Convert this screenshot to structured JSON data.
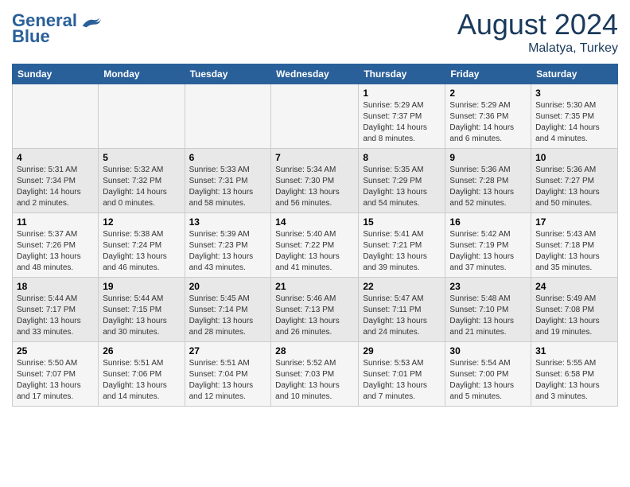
{
  "header": {
    "logo_line1": "General",
    "logo_line2": "Blue",
    "month_year": "August 2024",
    "location": "Malatya, Turkey"
  },
  "days_of_week": [
    "Sunday",
    "Monday",
    "Tuesday",
    "Wednesday",
    "Thursday",
    "Friday",
    "Saturday"
  ],
  "weeks": [
    [
      {
        "day": "",
        "info": ""
      },
      {
        "day": "",
        "info": ""
      },
      {
        "day": "",
        "info": ""
      },
      {
        "day": "",
        "info": ""
      },
      {
        "day": "1",
        "info": "Sunrise: 5:29 AM\nSunset: 7:37 PM\nDaylight: 14 hours\nand 8 minutes."
      },
      {
        "day": "2",
        "info": "Sunrise: 5:29 AM\nSunset: 7:36 PM\nDaylight: 14 hours\nand 6 minutes."
      },
      {
        "day": "3",
        "info": "Sunrise: 5:30 AM\nSunset: 7:35 PM\nDaylight: 14 hours\nand 4 minutes."
      }
    ],
    [
      {
        "day": "4",
        "info": "Sunrise: 5:31 AM\nSunset: 7:34 PM\nDaylight: 14 hours\nand 2 minutes."
      },
      {
        "day": "5",
        "info": "Sunrise: 5:32 AM\nSunset: 7:32 PM\nDaylight: 14 hours\nand 0 minutes."
      },
      {
        "day": "6",
        "info": "Sunrise: 5:33 AM\nSunset: 7:31 PM\nDaylight: 13 hours\nand 58 minutes."
      },
      {
        "day": "7",
        "info": "Sunrise: 5:34 AM\nSunset: 7:30 PM\nDaylight: 13 hours\nand 56 minutes."
      },
      {
        "day": "8",
        "info": "Sunrise: 5:35 AM\nSunset: 7:29 PM\nDaylight: 13 hours\nand 54 minutes."
      },
      {
        "day": "9",
        "info": "Sunrise: 5:36 AM\nSunset: 7:28 PM\nDaylight: 13 hours\nand 52 minutes."
      },
      {
        "day": "10",
        "info": "Sunrise: 5:36 AM\nSunset: 7:27 PM\nDaylight: 13 hours\nand 50 minutes."
      }
    ],
    [
      {
        "day": "11",
        "info": "Sunrise: 5:37 AM\nSunset: 7:26 PM\nDaylight: 13 hours\nand 48 minutes."
      },
      {
        "day": "12",
        "info": "Sunrise: 5:38 AM\nSunset: 7:24 PM\nDaylight: 13 hours\nand 46 minutes."
      },
      {
        "day": "13",
        "info": "Sunrise: 5:39 AM\nSunset: 7:23 PM\nDaylight: 13 hours\nand 43 minutes."
      },
      {
        "day": "14",
        "info": "Sunrise: 5:40 AM\nSunset: 7:22 PM\nDaylight: 13 hours\nand 41 minutes."
      },
      {
        "day": "15",
        "info": "Sunrise: 5:41 AM\nSunset: 7:21 PM\nDaylight: 13 hours\nand 39 minutes."
      },
      {
        "day": "16",
        "info": "Sunrise: 5:42 AM\nSunset: 7:19 PM\nDaylight: 13 hours\nand 37 minutes."
      },
      {
        "day": "17",
        "info": "Sunrise: 5:43 AM\nSunset: 7:18 PM\nDaylight: 13 hours\nand 35 minutes."
      }
    ],
    [
      {
        "day": "18",
        "info": "Sunrise: 5:44 AM\nSunset: 7:17 PM\nDaylight: 13 hours\nand 33 minutes."
      },
      {
        "day": "19",
        "info": "Sunrise: 5:44 AM\nSunset: 7:15 PM\nDaylight: 13 hours\nand 30 minutes."
      },
      {
        "day": "20",
        "info": "Sunrise: 5:45 AM\nSunset: 7:14 PM\nDaylight: 13 hours\nand 28 minutes."
      },
      {
        "day": "21",
        "info": "Sunrise: 5:46 AM\nSunset: 7:13 PM\nDaylight: 13 hours\nand 26 minutes."
      },
      {
        "day": "22",
        "info": "Sunrise: 5:47 AM\nSunset: 7:11 PM\nDaylight: 13 hours\nand 24 minutes."
      },
      {
        "day": "23",
        "info": "Sunrise: 5:48 AM\nSunset: 7:10 PM\nDaylight: 13 hours\nand 21 minutes."
      },
      {
        "day": "24",
        "info": "Sunrise: 5:49 AM\nSunset: 7:08 PM\nDaylight: 13 hours\nand 19 minutes."
      }
    ],
    [
      {
        "day": "25",
        "info": "Sunrise: 5:50 AM\nSunset: 7:07 PM\nDaylight: 13 hours\nand 17 minutes."
      },
      {
        "day": "26",
        "info": "Sunrise: 5:51 AM\nSunset: 7:06 PM\nDaylight: 13 hours\nand 14 minutes."
      },
      {
        "day": "27",
        "info": "Sunrise: 5:51 AM\nSunset: 7:04 PM\nDaylight: 13 hours\nand 12 minutes."
      },
      {
        "day": "28",
        "info": "Sunrise: 5:52 AM\nSunset: 7:03 PM\nDaylight: 13 hours\nand 10 minutes."
      },
      {
        "day": "29",
        "info": "Sunrise: 5:53 AM\nSunset: 7:01 PM\nDaylight: 13 hours\nand 7 minutes."
      },
      {
        "day": "30",
        "info": "Sunrise: 5:54 AM\nSunset: 7:00 PM\nDaylight: 13 hours\nand 5 minutes."
      },
      {
        "day": "31",
        "info": "Sunrise: 5:55 AM\nSunset: 6:58 PM\nDaylight: 13 hours\nand 3 minutes."
      }
    ]
  ]
}
